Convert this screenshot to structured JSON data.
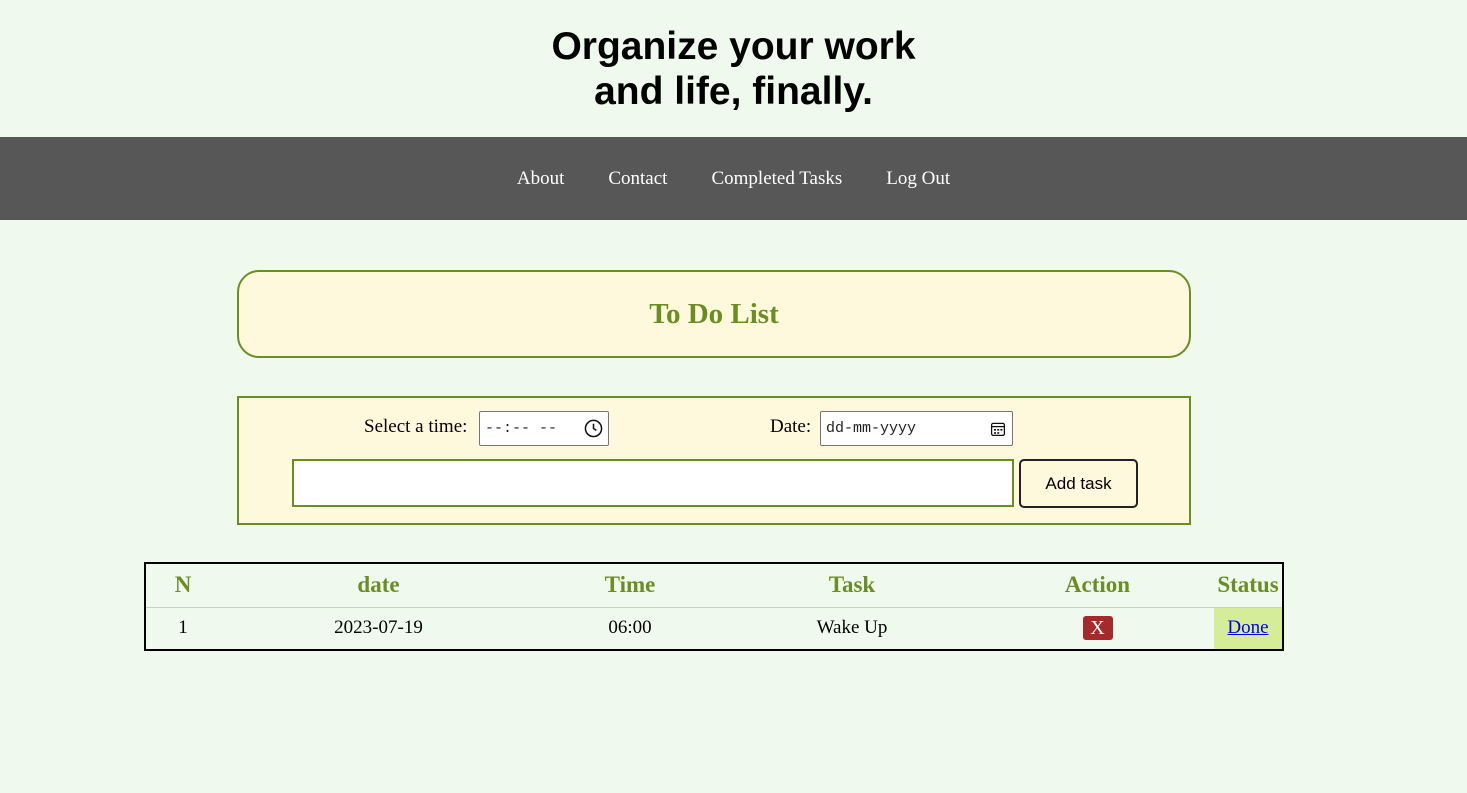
{
  "header": {
    "title_line1": "Organize your work",
    "title_line2": "and life, finally."
  },
  "nav": {
    "items": [
      {
        "label": "About"
      },
      {
        "label": "Contact"
      },
      {
        "label": "Completed Tasks"
      },
      {
        "label": "Log Out"
      }
    ]
  },
  "main": {
    "title": "To Do List",
    "form": {
      "time_label": "Select a time:",
      "time_value": "--:-- --",
      "date_label": "Date:",
      "date_value": "dd-mm-yyyy",
      "task_value": "",
      "add_button": "Add task"
    },
    "table": {
      "headers": [
        "N",
        "date",
        "Time",
        "Task",
        "Action",
        "Status"
      ],
      "rows": [
        {
          "n": "1",
          "date": "2023-07-19",
          "time": "06:00",
          "task": "Wake Up",
          "action": "X",
          "status": "Done"
        }
      ]
    }
  },
  "colors": {
    "page_bg": "#f0f9ee",
    "nav_bg": "#575757",
    "accent": "#6b8e23",
    "panel_bg": "#fef8dc",
    "delete": "#a52a2a",
    "status_bg": "#d5ec98"
  }
}
